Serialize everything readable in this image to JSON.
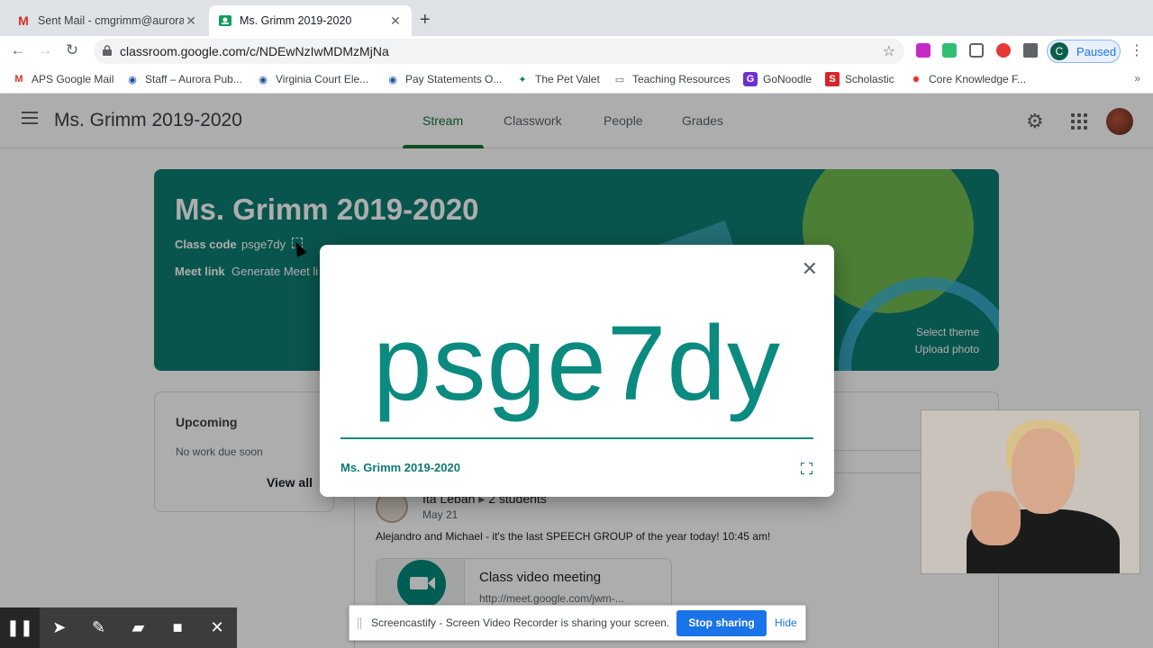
{
  "browser": {
    "tabs": [
      {
        "title": "Sent Mail - cmgrimm@aurorak",
        "favicon": "gmail-icon",
        "active": false
      },
      {
        "title": "Ms. Grimm 2019-2020",
        "favicon": "classroom-icon",
        "active": true
      }
    ],
    "new_tab": "+",
    "url": "classroom.google.com/c/NDEwNzIwMDMzMjNa",
    "profile_initial": "C",
    "profile_label": "Paused",
    "bookmarks": [
      "APS Google Mail",
      "Staff – Aurora Pub...",
      "Virginia Court Ele...",
      "Pay Statements O...",
      "The Pet Valet",
      "Teaching Resources",
      "GoNoodle",
      "Scholastic",
      "Core Knowledge F..."
    ],
    "bookmarks_more": "»"
  },
  "classroom": {
    "class_name": "Ms. Grimm 2019-2020",
    "nav": [
      "Stream",
      "Classwork",
      "People",
      "Grades"
    ],
    "active_nav": "Stream",
    "banner": {
      "title": "Ms. Grimm 2019-2020",
      "class_code_label": "Class code",
      "class_code": "psge7dy",
      "meet_link_label": "Meet link",
      "meet_link_value": "Generate Meet li",
      "select_theme": "Select theme",
      "upload_photo": "Upload photo"
    },
    "upcoming": {
      "title": "Upcoming",
      "empty": "No work due soon",
      "view_all": "View all"
    },
    "post": {
      "author": "Ita Leban",
      "audience": "2 students",
      "date": "May 21",
      "text": "Alejandro and Michael - it's the last SPEECH GROUP of the year today! 10:45 am!",
      "meeting_title": "Class video meeting",
      "meeting_url": "http://meet.google.com/jwm-..."
    }
  },
  "modal": {
    "code": "psge7dy",
    "class_name": "Ms. Grimm 2019-2020",
    "close": "✕"
  },
  "screencastify": {
    "share_text": "Screencastify - Screen Video Recorder is sharing your screen.",
    "stop_label": "Stop sharing",
    "hide_label": "Hide",
    "tools": [
      "pause-icon",
      "pointer-icon",
      "pen-icon",
      "eraser-icon",
      "camera-icon",
      "close-icon"
    ]
  },
  "colors": {
    "accent": "#137333",
    "banner": "#0d7e72",
    "code_text": "#0b8a80",
    "primary_button": "#1a73e8"
  }
}
